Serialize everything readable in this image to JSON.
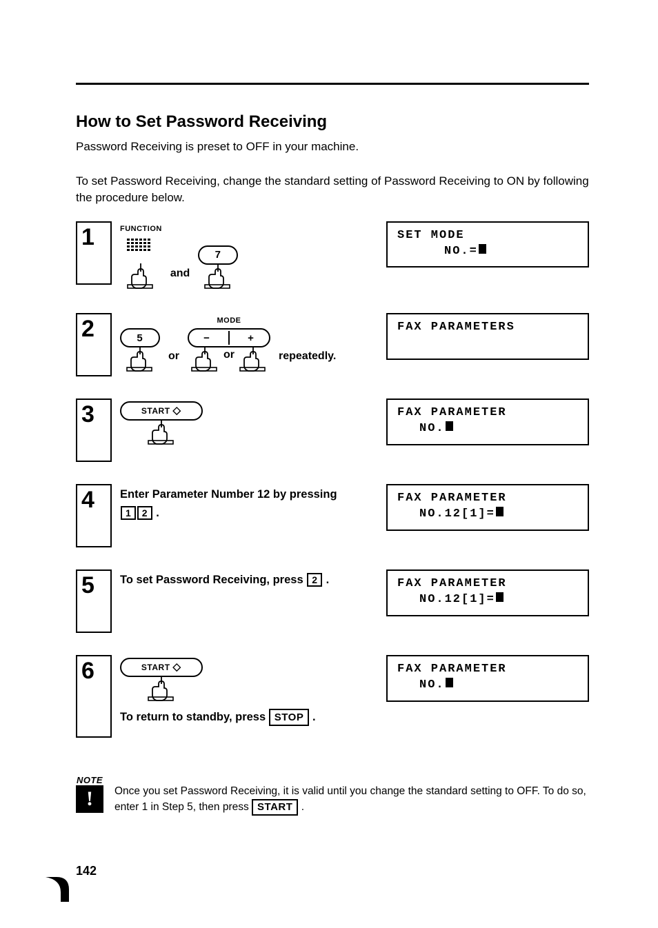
{
  "title": "How to Set Password Receiving",
  "intro1": "Password Receiving is preset to OFF in your machine.",
  "intro2": "To set Password Receiving, change the standard setting of Password Receiving to ON by following the procedure below.",
  "steps": [
    {
      "label": "1",
      "func_label": "FUNCTION",
      "and": "and",
      "key7": "7",
      "display_line1": "SET MODE",
      "display_line2": "NO.="
    },
    {
      "label": "2",
      "mode_label": "MODE",
      "key5": "5",
      "minus": "−",
      "plus": "+",
      "or": "or",
      "repeatedly": "repeatedly.",
      "display_line1": "FAX PARAMETERS",
      "display_line2": ""
    },
    {
      "label": "3",
      "start": "START",
      "display_line1": "FAX PARAMETER",
      "display_line2": "NO."
    },
    {
      "label": "4",
      "text_a": "Enter Parameter Number 12 by pressing",
      "key1": "1",
      "key2": "2",
      "period": ".",
      "display_line1": "FAX PARAMETER",
      "display_line2": "NO.12[1]="
    },
    {
      "label": "5",
      "text_a": "To set Password Receiving, press",
      "key2": "2",
      "period": ".",
      "display_line1": "FAX PARAMETER",
      "display_line2": "NO.12[1]="
    },
    {
      "label": "6",
      "start": "START",
      "text_below": "To return to standby, press",
      "stop_key": "STOP",
      "period": ".",
      "display_line1": "FAX PARAMETER",
      "display_line2": "NO."
    }
  ],
  "note": {
    "label": "NOTE",
    "bang": "!",
    "text_a": "Once you set Password Receiving, it is valid until you change the standard setting to OFF. To do so, enter 1 in Step 5, then press",
    "start_key": "START",
    "period": "."
  },
  "page_number": "142"
}
